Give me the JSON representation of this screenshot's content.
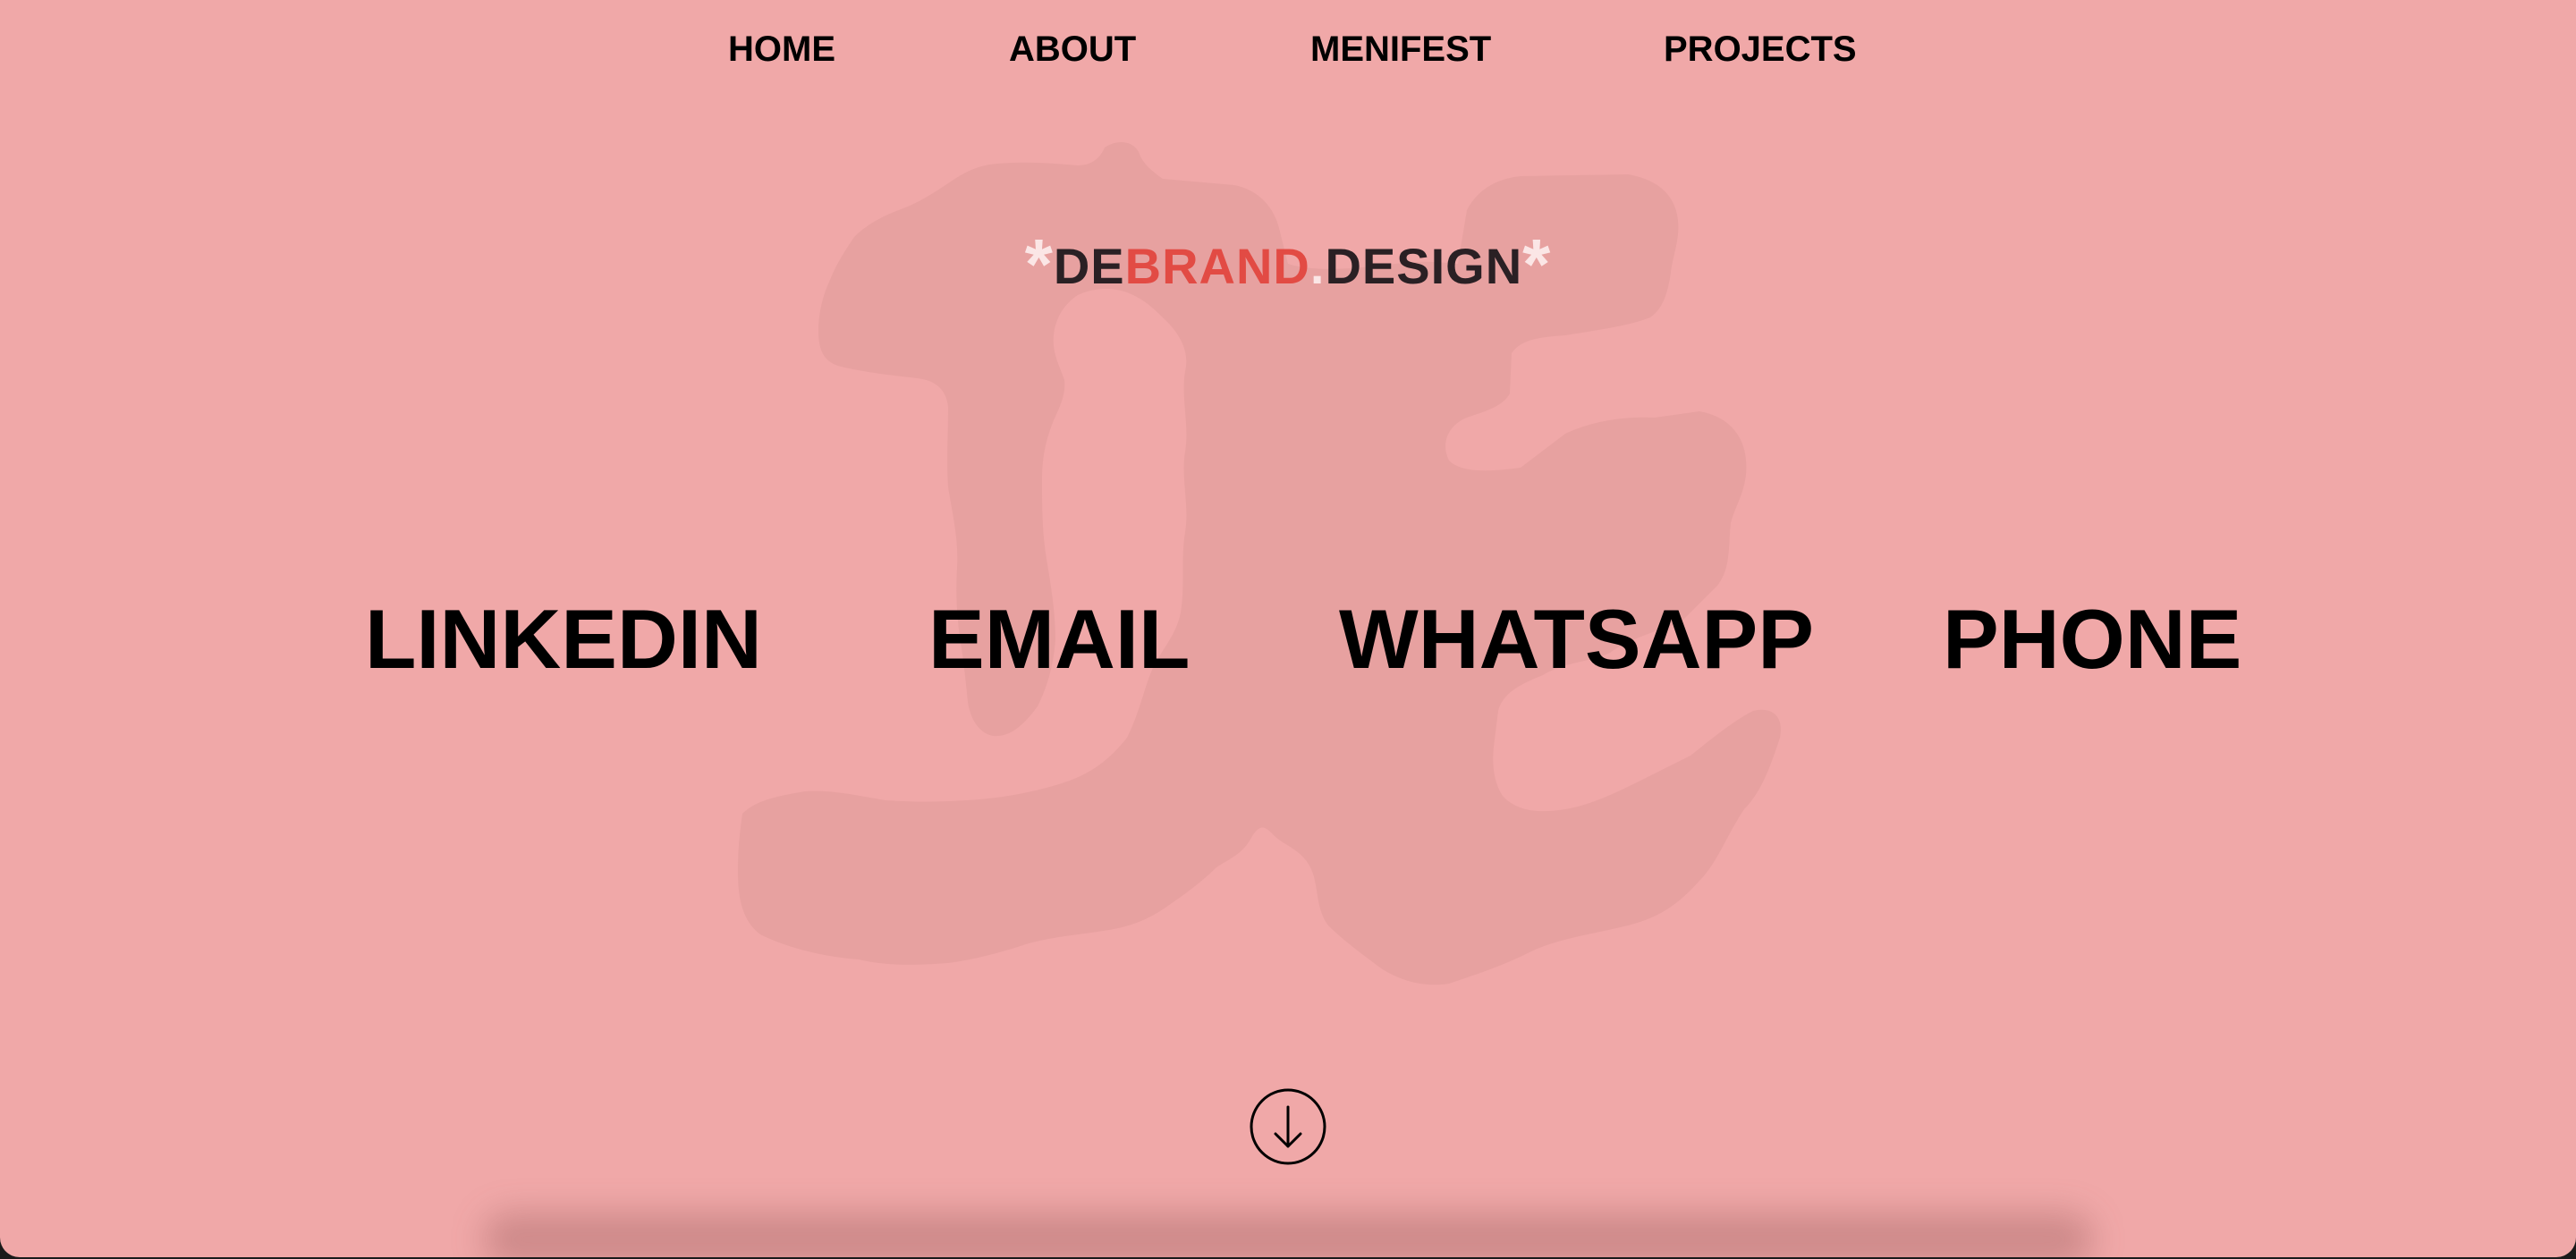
{
  "nav": {
    "items": [
      {
        "label": "HOME"
      },
      {
        "label": "ABOUT"
      },
      {
        "label": "MENIFEST"
      },
      {
        "label": "PROJECTS"
      }
    ]
  },
  "brand": {
    "star_left": "*",
    "de": "DE",
    "brand": "BRAND",
    "dot": ".",
    "design": "DESIGN",
    "star_right": "*"
  },
  "contacts": [
    {
      "label": "LINKEDIN"
    },
    {
      "label": "EMAIL"
    },
    {
      "label": "WHATSAPP"
    },
    {
      "label": "PHONE"
    }
  ],
  "scroll_icon": "arrow-down-circle-icon",
  "colors": {
    "background": "#f0a8a8",
    "watermark": "#e7a1a0",
    "accent": "#e24b44",
    "text": "#000000",
    "brand_dark": "#2a2024",
    "star": "#fbe6e6"
  }
}
